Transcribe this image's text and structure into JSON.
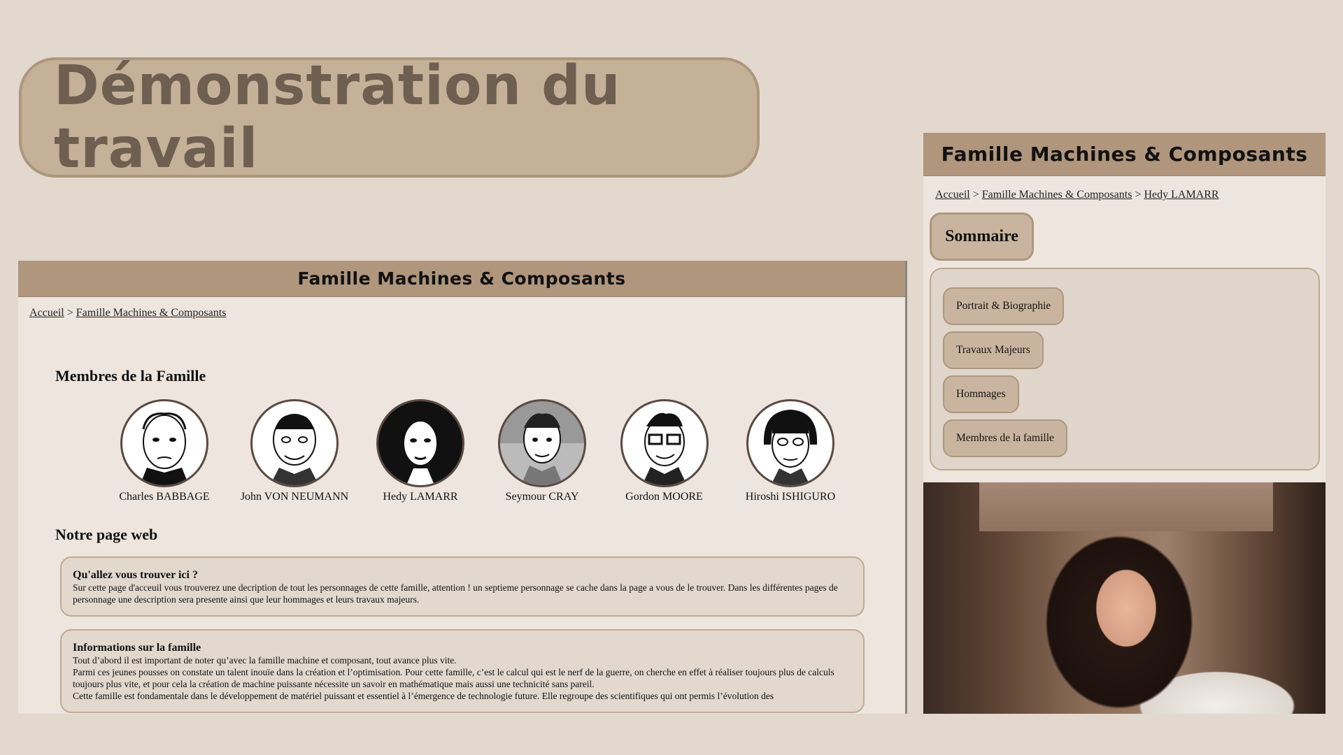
{
  "slide": {
    "title": "Démonstration du travail"
  },
  "left_page": {
    "header_title": "Famille Machines & Composants",
    "breadcrumb": {
      "home": "Accueil",
      "separator": ">",
      "current": "Famille Machines & Composants"
    },
    "members_heading": "Membres de la Famille",
    "members": [
      {
        "name": "Charles BABBAGE"
      },
      {
        "name": "John VON NEUMANN"
      },
      {
        "name": "Hedy LAMARR"
      },
      {
        "name": "Seymour CRAY"
      },
      {
        "name": "Gordon MOORE"
      },
      {
        "name": "Hiroshi ISHIGURO"
      }
    ],
    "webpage_heading": "Notre page web",
    "cards": [
      {
        "title": "Qu'allez vous trouver ici ?",
        "text": "Sur cette page d'acceuil vous trouverez une decription de tout les personnages de cette famille, attention ! un septieme personnage se cache dans la page a vous de le trouver. Dans les différentes pages de personnage une description sera presente ainsi que leur hommages et leurs travaux majeurs."
      },
      {
        "title": "Informations sur la famille",
        "line1": "Tout d’abord il est important de noter qu’avec la famille machine et composant, tout avance plus vite.",
        "line2": "Parmi ces jeunes pousses on constate un talent inouïe dans la création et l’optimisation. Pour cette famille, c’est le calcul qui est le nerf de la guerre, on cherche en effet à réaliser toujours plus de calculs toujours plus vite, et pour cela la création de machine puissante nécessite un savoir en mathématique mais aussi une technicité sans pareil.",
        "line3": "Cette famille est fondamentale dans le développement de matériel puissant et essentiel à l’émergence de technologie future. Elle regroupe des scientifiques qui ont permis l’évolution des"
      }
    ]
  },
  "right_page": {
    "header_title": "Famille Machines & Composants",
    "breadcrumb": {
      "home": "Accueil",
      "separator": ">",
      "family": "Famille Machines & Composants",
      "separator2": ">",
      "current": "Hedy LAMARR"
    },
    "sommaire_label": "Sommaire",
    "sommaire_items": [
      "Portrait & Biographie",
      "Travaux Majeurs",
      "Hommages",
      "Membres de la famille"
    ]
  },
  "colors": {
    "background": "#e2d8cd",
    "header": "#af967d",
    "pill": "#c5b098",
    "title_text": "#6e5f51",
    "page_bg": "#ede5de"
  }
}
